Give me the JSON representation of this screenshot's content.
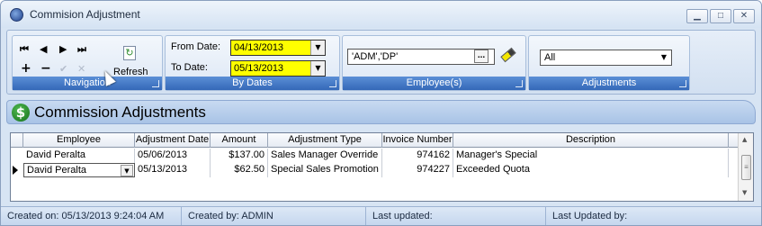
{
  "window": {
    "title": "Commision Adjustment"
  },
  "ribbon": {
    "navigation": {
      "label": "Navigation",
      "first": "⏮",
      "prev": "◀",
      "next": "▶",
      "last": "⏭",
      "add": "+",
      "delete": "−",
      "save": "✔",
      "cancel": "✕",
      "refresh_label": "Refresh"
    },
    "by_dates": {
      "label": "By Dates",
      "from_label": "From Date:",
      "from_value": "04/13/2013",
      "to_label": "To Date:",
      "to_value": "05/13/2013"
    },
    "employees": {
      "label": "Employee(s)",
      "value": "'ADM','DP'",
      "dots": "..."
    },
    "adjustments": {
      "label": "Adjustments",
      "value": "All"
    }
  },
  "section": {
    "title": "Commission Adjustments"
  },
  "grid": {
    "columns": [
      "Employee",
      "Adjustment Date",
      "Amount",
      "Adjustment Type",
      "Invoice Number",
      "Description"
    ],
    "rows": [
      {
        "employee": "David Peralta",
        "date": "05/06/2013",
        "amount": "$137.00",
        "type": "Sales Manager Override",
        "invoice": "974162",
        "description": "Manager's Special"
      },
      {
        "employee": "David Peralta",
        "date": "05/13/2013",
        "amount": "$62.50",
        "type": "Special Sales Promotion",
        "invoice": "974227",
        "description": "Exceeded Quota"
      }
    ]
  },
  "status": {
    "created_on": "Created on: 05/13/2013 9:24:04 AM",
    "created_by": "Created by: ADMIN",
    "last_updated": "Last updated:",
    "last_updated_by": "Last Updated by:"
  },
  "colors": {
    "date_field": "#ffff00",
    "group_label": "#3468b8"
  }
}
